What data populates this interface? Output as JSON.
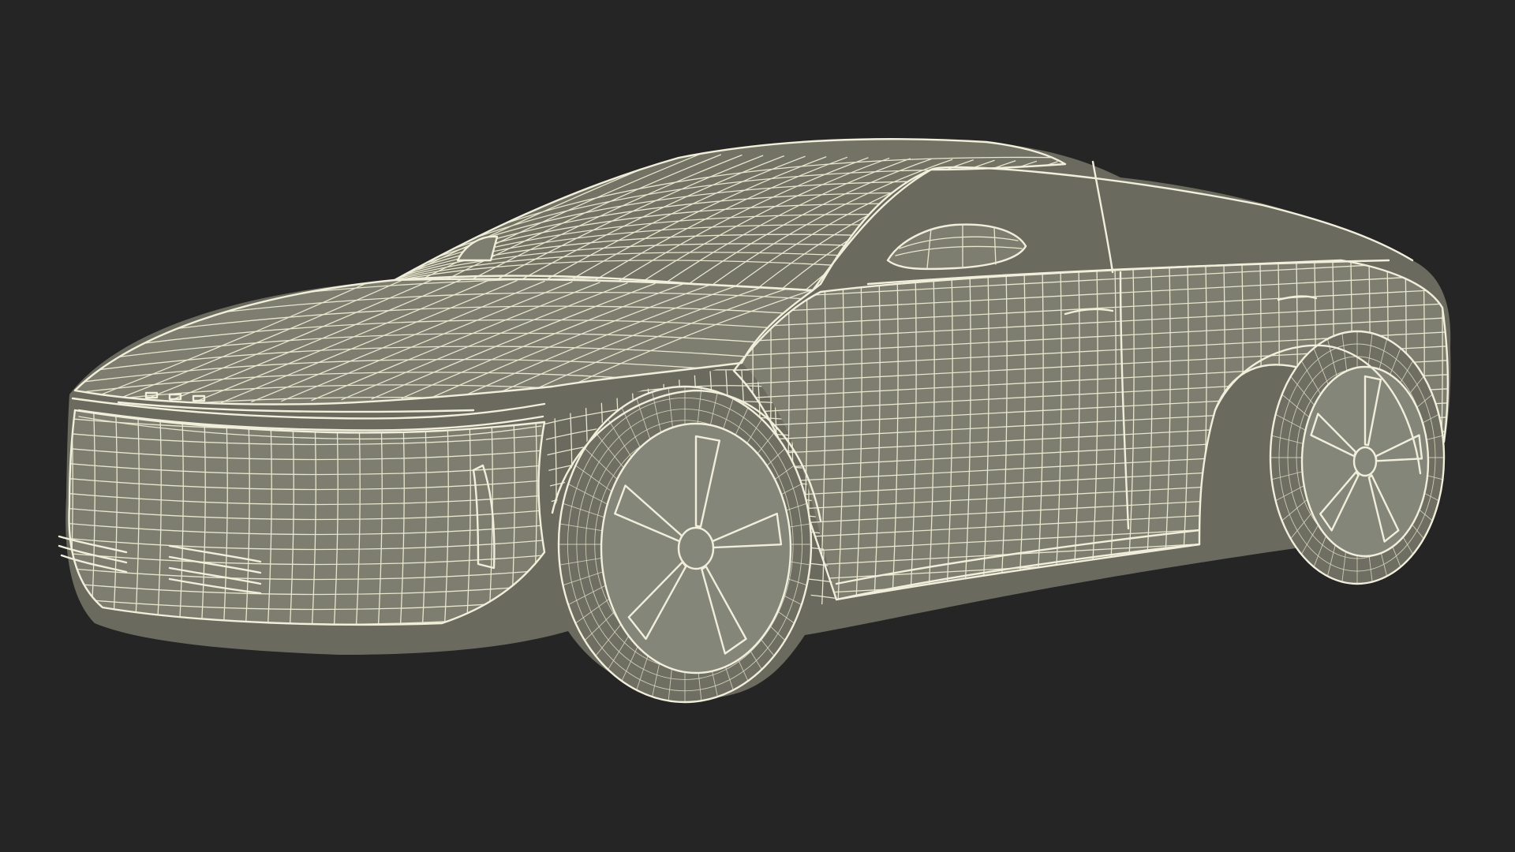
{
  "scene": {
    "subject": "car",
    "render_style": "wireframe",
    "colors": {
      "background": "#252525",
      "surface": "#7d7e6f",
      "surface_shadow": "#6a6b5e",
      "wire": "#e8e6cf"
    }
  }
}
